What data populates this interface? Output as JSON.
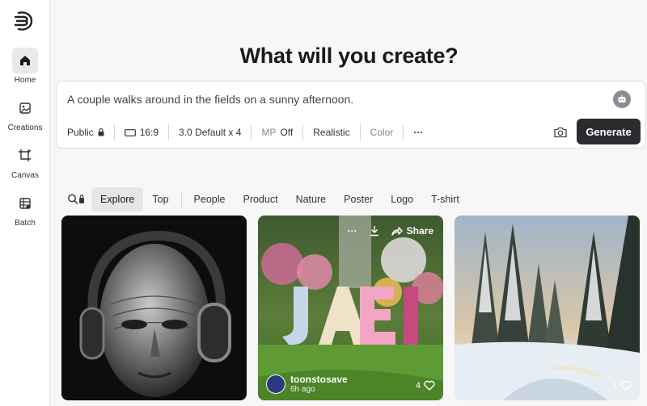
{
  "sidebar": {
    "items": [
      {
        "label": "Home",
        "icon": "home-icon",
        "active": true
      },
      {
        "label": "Creations",
        "icon": "image-icon"
      },
      {
        "label": "Canvas",
        "icon": "canvas-icon"
      },
      {
        "label": "Batch",
        "icon": "batch-icon"
      }
    ]
  },
  "headline": "What will you create?",
  "prompt": {
    "text": "A couple walks around in the fields on a sunny afternoon.",
    "options": {
      "visibility": "Public",
      "aspect": "16:9",
      "model": "3.0 Default x 4",
      "mp_label": "MP",
      "mp_value": "Off",
      "style": "Realistic",
      "color": "Color",
      "more": "···"
    },
    "generate_label": "Generate"
  },
  "filters": [
    "Explore",
    "Top",
    "People",
    "Product",
    "Nature",
    "Poster",
    "Logo",
    "T-shirt"
  ],
  "active_filter": "Explore",
  "cards": [
    {
      "subject": "metal mask with headphones"
    },
    {
      "subject": "JAEL flower letters",
      "toolbar": {
        "more": "···",
        "share": "Share"
      },
      "author": "toonstosave",
      "time": "6h ago",
      "likes": "4"
    },
    {
      "subject": "snowy forest",
      "likes": "1"
    }
  ],
  "colors": {
    "accent": "#2b2c30",
    "active_bg": "#e9e9eb"
  }
}
